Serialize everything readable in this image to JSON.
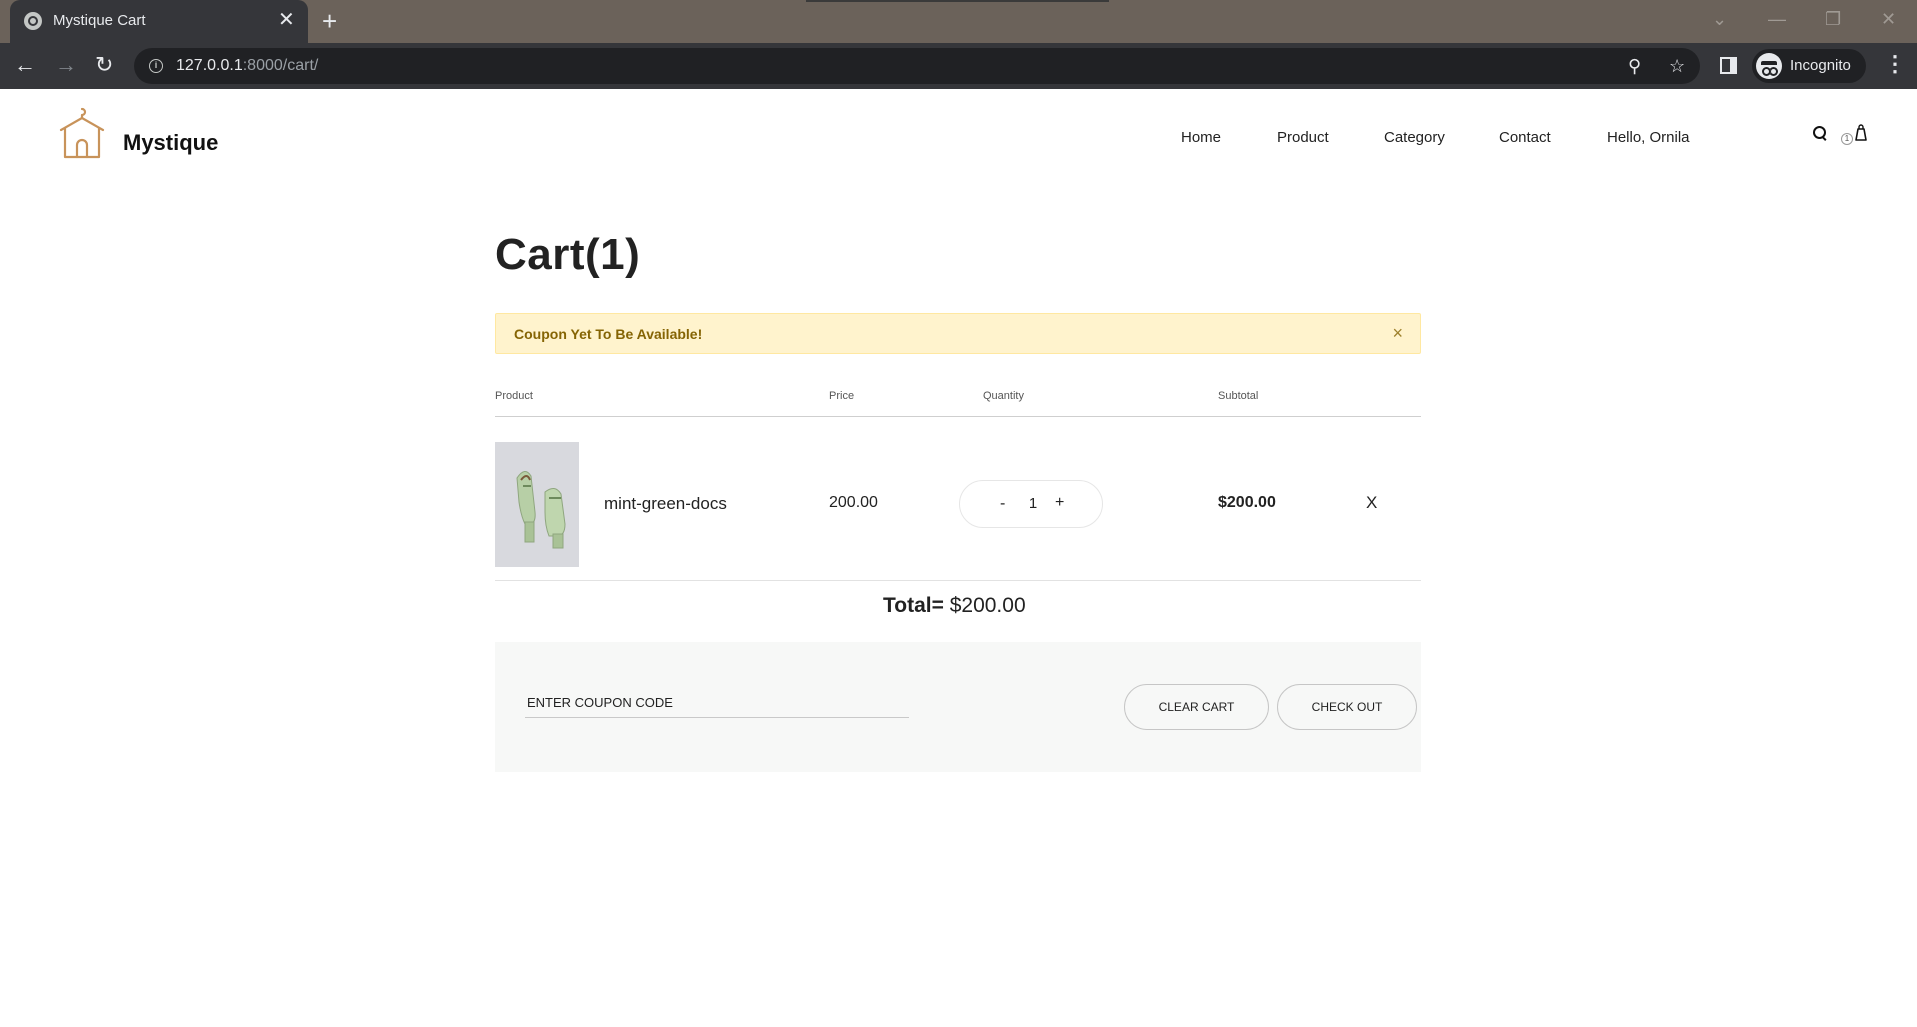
{
  "browser": {
    "tab_title": "Mystique Cart",
    "new_tab_symbol": "+",
    "tab_close_symbol": "✕",
    "url_host": "127.0.0.1",
    "url_path": ":8000/cart/",
    "profile_label": "Incognito"
  },
  "site": {
    "brand": "Mystique",
    "nav": [
      {
        "label": "Home"
      },
      {
        "label": "Product"
      },
      {
        "label": "Category"
      },
      {
        "label": "Contact"
      },
      {
        "label": "Hello, Ornila"
      }
    ],
    "cart_count": "1"
  },
  "cart": {
    "title": "Cart(1)",
    "alert": {
      "message": "Coupon Yet To Be Available!",
      "close_symbol": "×"
    },
    "columns": {
      "product": "Product",
      "price": "Price",
      "quantity": "Quantity",
      "subtotal": "Subtotal"
    },
    "items": [
      {
        "name": "mint-green-docs",
        "price": "200.00",
        "quantity": "1",
        "subtotal": "$200.00",
        "remove_label": "X"
      }
    ],
    "qty_minus": "-",
    "qty_plus": "+",
    "total_label": "Total=",
    "total_value": "$200.00",
    "coupon_placeholder": "ENTER COUPON CODE",
    "clear_cart_label": "CLEAR CART",
    "checkout_label": "CHECK OUT"
  },
  "colors": {
    "alert_bg": "#fff3cd",
    "alert_text": "#856404",
    "logo_accent": "#c8935a",
    "coupon_panel_bg": "#f7f8f7"
  }
}
